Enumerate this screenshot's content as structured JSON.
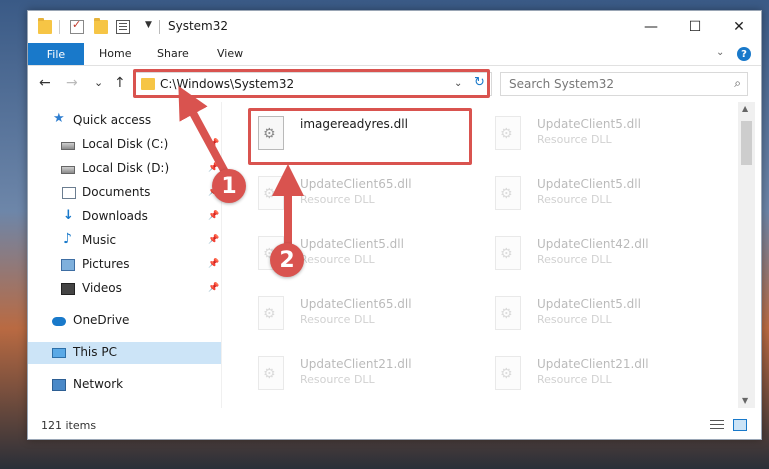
{
  "window": {
    "title": "System32",
    "controls": {
      "minimize": "—",
      "maximize": "☐",
      "close": "✕"
    }
  },
  "ribbon": {
    "tabs": [
      "File",
      "Home",
      "Share",
      "View"
    ],
    "help": "?"
  },
  "nav": {
    "back": "←",
    "forward": "→",
    "recent": "⌄",
    "up": "↑",
    "address": "C:\\Windows\\System32",
    "address_dropdown": "⌄",
    "refresh": "↻",
    "search_placeholder": "Search System32",
    "search_icon": "search-icon"
  },
  "sidebar": {
    "items": [
      {
        "label": "Quick access",
        "icon": "star-icon",
        "pinned": false
      },
      {
        "label": "Local Disk (C:)",
        "icon": "disk-icon",
        "pinned": true
      },
      {
        "label": "Local Disk (D:)",
        "icon": "disk-icon",
        "pinned": true
      },
      {
        "label": "Documents",
        "icon": "documents-icon",
        "pinned": true
      },
      {
        "label": "Downloads",
        "icon": "download-icon",
        "pinned": true
      },
      {
        "label": "Music",
        "icon": "music-icon",
        "pinned": true
      },
      {
        "label": "Pictures",
        "icon": "pictures-icon",
        "pinned": true
      },
      {
        "label": "Videos",
        "icon": "video-icon",
        "pinned": true
      },
      {
        "label": "OneDrive",
        "icon": "cloud-icon",
        "pinned": false
      },
      {
        "label": "This PC",
        "icon": "computer-icon",
        "pinned": false,
        "selected": true
      },
      {
        "label": "Network",
        "icon": "network-icon",
        "pinned": false
      }
    ]
  },
  "files": [
    {
      "name": "imagereadyres.dll",
      "type": "",
      "highlighted": true
    },
    {
      "name": "UpdateClient5.dll",
      "type": "Resource DLL"
    },
    {
      "name": "UpdateClient65.dll",
      "type": "Resource DLL"
    },
    {
      "name": "UpdateClient5.dll",
      "type": "Resource DLL"
    },
    {
      "name": "UpdateClient5.dll",
      "type": "Resource DLL"
    },
    {
      "name": "UpdateClient42.dll",
      "type": "Resource DLL"
    },
    {
      "name": "UpdateClient65.dll",
      "type": "Resource DLL"
    },
    {
      "name": "UpdateClient5.dll",
      "type": "Resource DLL"
    },
    {
      "name": "UpdateClient21.dll",
      "type": "Resource DLL"
    },
    {
      "name": "UpdateClient21.dll",
      "type": "Resource DLL"
    }
  ],
  "status": {
    "count": "121 items"
  },
  "annotations": {
    "step1": "1",
    "step2": "2",
    "color": "#d9534f"
  }
}
